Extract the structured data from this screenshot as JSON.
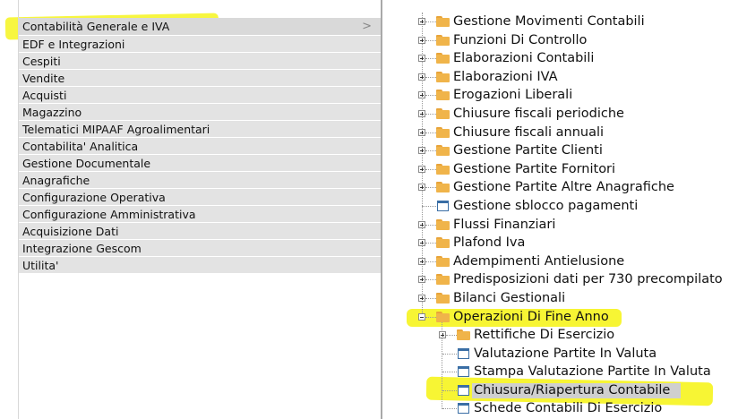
{
  "left_menu": {
    "chevron": ">",
    "items": [
      {
        "label": "Contabilità Generale e IVA"
      },
      {
        "label": "EDF e Integrazioni"
      },
      {
        "label": "Cespiti"
      },
      {
        "label": "Vendite"
      },
      {
        "label": "Acquisti"
      },
      {
        "label": "Magazzino"
      },
      {
        "label": "Telematici MIPAAF Agroalimentari"
      },
      {
        "label": "Contabilita' Analitica"
      },
      {
        "label": "Gestione Documentale"
      },
      {
        "label": "Anagrafiche"
      },
      {
        "label": "Configurazione Operativa"
      },
      {
        "label": "Configurazione Amministrativa"
      },
      {
        "label": "Acquisizione Dati"
      },
      {
        "label": "Integrazione Gescom"
      },
      {
        "label": "Utilita'"
      }
    ]
  },
  "tree": {
    "items": [
      {
        "label": "Gestione Movimenti Contabili",
        "type": "folder",
        "level": 0,
        "expander": "plus"
      },
      {
        "label": "Funzioni Di Controllo",
        "type": "folder",
        "level": 0,
        "expander": "plus"
      },
      {
        "label": "Elaborazioni Contabili",
        "type": "folder",
        "level": 0,
        "expander": "plus"
      },
      {
        "label": "Elaborazioni IVA",
        "type": "folder",
        "level": 0,
        "expander": "plus"
      },
      {
        "label": "Erogazioni Liberali",
        "type": "folder",
        "level": 0,
        "expander": "plus"
      },
      {
        "label": "Chiusure fiscali periodiche",
        "type": "folder",
        "level": 0,
        "expander": "plus"
      },
      {
        "label": "Chiusure fiscali annuali",
        "type": "folder",
        "level": 0,
        "expander": "plus"
      },
      {
        "label": "Gestione Partite Clienti",
        "type": "folder",
        "level": 0,
        "expander": "plus"
      },
      {
        "label": "Gestione Partite Fornitori",
        "type": "folder",
        "level": 0,
        "expander": "plus"
      },
      {
        "label": "Gestione Partite Altre Anagrafiche",
        "type": "folder",
        "level": 0,
        "expander": "plus"
      },
      {
        "label": "Gestione sblocco pagamenti",
        "type": "window",
        "level": 0,
        "expander": "none"
      },
      {
        "label": "Flussi Finanziari",
        "type": "folder",
        "level": 0,
        "expander": "plus"
      },
      {
        "label": "Plafond Iva",
        "type": "folder",
        "level": 0,
        "expander": "plus"
      },
      {
        "label": "Adempimenti Antielusione",
        "type": "folder",
        "level": 0,
        "expander": "plus"
      },
      {
        "label": "Predisposizioni dati per 730 precompilato",
        "type": "folder",
        "level": 0,
        "expander": "plus"
      },
      {
        "label": "Bilanci Gestionali",
        "type": "folder",
        "level": 0,
        "expander": "plus"
      },
      {
        "label": "Operazioni Di Fine Anno",
        "type": "folder",
        "level": 0,
        "expander": "minus"
      },
      {
        "label": "Rettifiche Di Esercizio",
        "type": "folder",
        "level": 1,
        "expander": "plus"
      },
      {
        "label": "Valutazione Partite In Valuta",
        "type": "window",
        "level": 1,
        "expander": "none"
      },
      {
        "label": "Stampa Valutazione Partite In Valuta",
        "type": "window",
        "level": 1,
        "expander": "none"
      },
      {
        "label": "Chiusura/Riapertura Contabile",
        "type": "window",
        "level": 1,
        "expander": "none",
        "selected": true
      },
      {
        "label": "Schede Contabili Di Esercizio",
        "type": "window",
        "level": 1,
        "expander": "none"
      }
    ]
  },
  "colors": {
    "highlighter": "#f6f41e",
    "menu_bg": "#e3e3e3",
    "folder": "#f0b44a",
    "window_icon": "#3a6ea5"
  }
}
